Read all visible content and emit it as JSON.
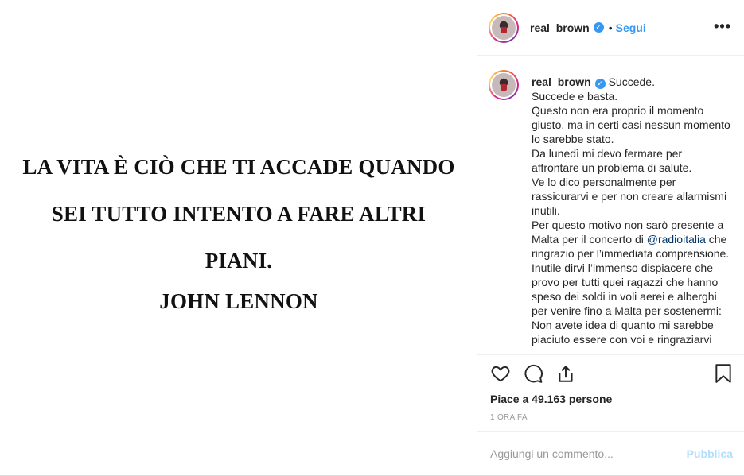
{
  "image": {
    "quote_lines": [
      "LA VITA È CIÒ CHE TI ACCADE QUANDO",
      "SEI TUTTO INTENTO A FARE ALTRI",
      "PIANI."
    ],
    "author": "JOHN LENNON"
  },
  "header": {
    "username": "real_brown",
    "separator": "•",
    "follow_label": "Segui",
    "more_label": "•••"
  },
  "caption": {
    "username": "real_brown",
    "first": "Succede.",
    "lines": [
      "Succede e basta.",
      "Questo non era proprio il momento giusto, ma in certi casi nessun momento lo sarebbe stato.",
      "Da lunedì mi devo fermare per affrontare un problema di salute.",
      "Ve lo dico personalmente per rassicurarvi e per non creare allarmismi inutili."
    ],
    "malta_pre": "Per questo motivo non sarò presente a Malta per il concerto di",
    "mention": "@radioitalia",
    "malta_post": "che ringrazio per l’immediata comprensione.",
    "more_lines": [
      "Inutile dirvi l’immenso dispiacere che provo per tutti quei ragazzi che hanno speso dei soldi in voli aerei e alberghi per venire fino a Malta per sostenermi:",
      "Non avete idea di quanto mi sarebbe piaciuto essere con voi e ringraziarvi"
    ]
  },
  "actions": {
    "icons": [
      "heart-icon",
      "comment-icon",
      "share-icon",
      "bookmark-icon"
    ]
  },
  "likes": {
    "text": "Piace a 49.163 persone"
  },
  "time": {
    "text": "1 ORA FA"
  },
  "comment": {
    "placeholder": "Aggiungi un commento...",
    "publish_label": "Pubblica"
  },
  "colors": {
    "accent": "#3897f0",
    "publish_disabled": "#b2dffc",
    "mention": "#003569"
  }
}
